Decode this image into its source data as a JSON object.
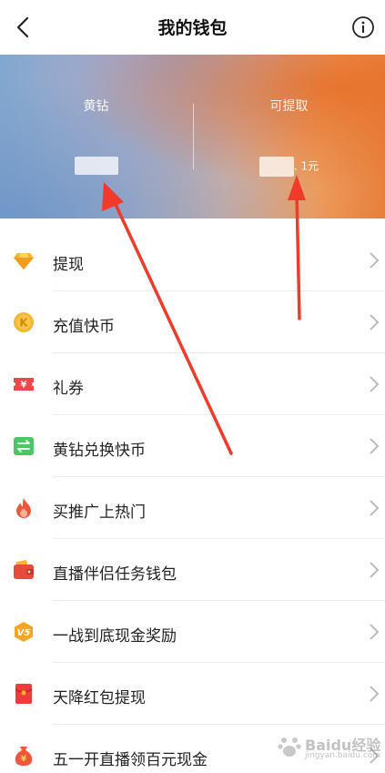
{
  "header": {
    "title": "我的钱包"
  },
  "banner": {
    "left": {
      "label": "黄钻",
      "value": ""
    },
    "right": {
      "label": "可提取",
      "value_suffix": ". 1元"
    }
  },
  "menu": [
    {
      "label": "提现",
      "icon": "diamond-icon"
    },
    {
      "label": "充值快币",
      "icon": "coin-k-icon"
    },
    {
      "label": "礼券",
      "icon": "coupon-icon"
    },
    {
      "label": "黄钻兑换快币",
      "icon": "exchange-icon"
    },
    {
      "label": "买推广上热门",
      "icon": "flame-icon"
    },
    {
      "label": "直播伴侣任务钱包",
      "icon": "wallet-icon"
    },
    {
      "label": "一战到底现金奖励",
      "icon": "v5-badge-icon"
    },
    {
      "label": "天降红包提现",
      "icon": "red-envelope-icon"
    },
    {
      "label": "五一开直播领百元现金",
      "icon": "money-bag-icon"
    }
  ],
  "colors": {
    "diamond": "#f5b731",
    "coin": "#f5b731",
    "coupon": "#f04848",
    "exchange": "#4cc763",
    "flame": "#f2553a",
    "wallet": "#e84b3a",
    "badge": "#f5a623",
    "envelope": "#ef3b3b",
    "bag": "#f0563a",
    "arrow": "#f03a2a"
  },
  "watermark": {
    "text": "Baidu经验",
    "sub": "jingyan.baidu.com"
  }
}
